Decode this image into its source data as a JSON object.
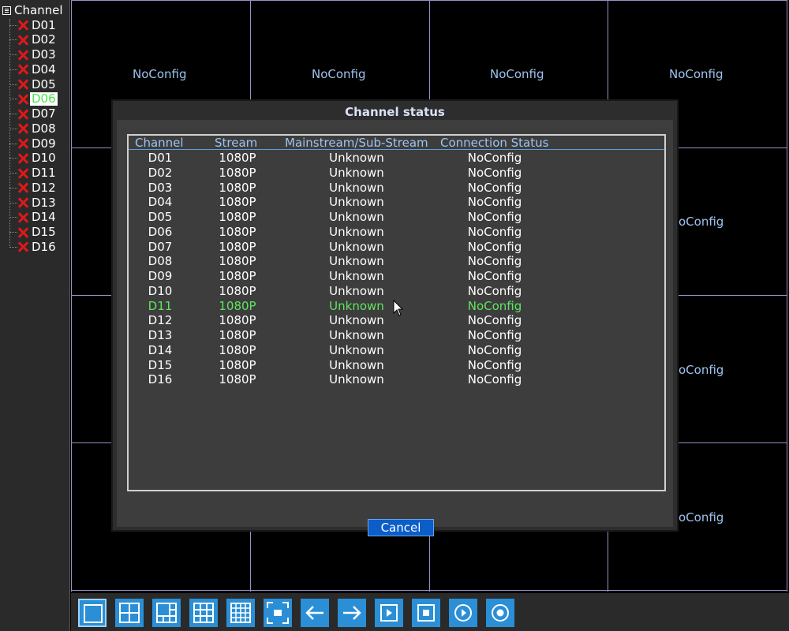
{
  "sidebar": {
    "header": "Channel",
    "items": [
      "D01",
      "D02",
      "D03",
      "D04",
      "D05",
      "D06",
      "D07",
      "D08",
      "D09",
      "D10",
      "D11",
      "D12",
      "D13",
      "D14",
      "D15",
      "D16"
    ],
    "selected": "D06"
  },
  "tiles": [
    "NoConfig",
    "NoConfig",
    "NoConfig",
    "NoConfig",
    "oConfig",
    "oConfig",
    "oConfig"
  ],
  "dialog": {
    "title": "Channel status",
    "columns": [
      "Channel",
      "Stream",
      "Mainstream/Sub-Stream",
      "Connection Status"
    ],
    "rows": [
      [
        "D01",
        "1080P",
        "Unknown",
        "NoConfig"
      ],
      [
        "D02",
        "1080P",
        "Unknown",
        "NoConfig"
      ],
      [
        "D03",
        "1080P",
        "Unknown",
        "NoConfig"
      ],
      [
        "D04",
        "1080P",
        "Unknown",
        "NoConfig"
      ],
      [
        "D05",
        "1080P",
        "Unknown",
        "NoConfig"
      ],
      [
        "D06",
        "1080P",
        "Unknown",
        "NoConfig"
      ],
      [
        "D07",
        "1080P",
        "Unknown",
        "NoConfig"
      ],
      [
        "D08",
        "1080P",
        "Unknown",
        "NoConfig"
      ],
      [
        "D09",
        "1080P",
        "Unknown",
        "NoConfig"
      ],
      [
        "D10",
        "1080P",
        "Unknown",
        "NoConfig"
      ],
      [
        "D11",
        "1080P",
        "Unknown",
        "NoConfig"
      ],
      [
        "D12",
        "1080P",
        "Unknown",
        "NoConfig"
      ],
      [
        "D13",
        "1080P",
        "Unknown",
        "NoConfig"
      ],
      [
        "D14",
        "1080P",
        "Unknown",
        "NoConfig"
      ],
      [
        "D15",
        "1080P",
        "Unknown",
        "NoConfig"
      ],
      [
        "D16",
        "1080P",
        "Unknown",
        "NoConfig"
      ]
    ],
    "highlighted_row": "D11",
    "cancel_label": "Cancel"
  },
  "toolbar": {
    "buttons": [
      "single-view-icon",
      "quad-view-icon",
      "six-view-icon",
      "nine-view-icon",
      "sixteen-view-icon",
      "fullscreen-icon",
      "arrow-left-icon",
      "arrow-right-icon",
      "play-icon",
      "stop-icon",
      "playback-icon",
      "record-icon"
    ],
    "active": "single-view-icon"
  },
  "colors": {
    "grid_line": "#9b8fc8",
    "tile_text": "#9ec3ee",
    "highlight_text": "#5ee65e",
    "accent_button": "#0b5ec8",
    "toolbar_button": "#2a8fd6",
    "error_x": "#e01818"
  }
}
